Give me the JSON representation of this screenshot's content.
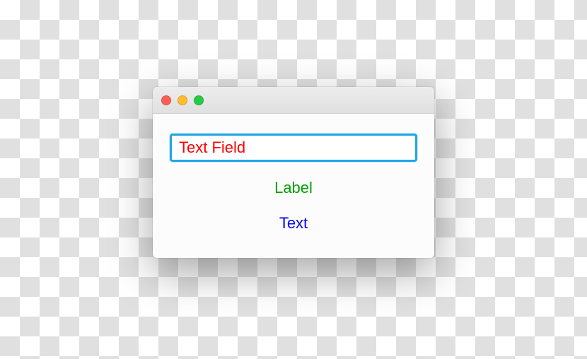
{
  "window": {
    "textfield": {
      "value": "Text Field"
    },
    "label": "Label",
    "text": "Text"
  }
}
